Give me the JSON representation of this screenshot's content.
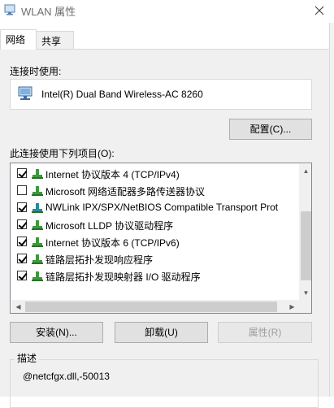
{
  "window": {
    "title": "WLAN 属性"
  },
  "tabs": [
    {
      "label": "网络",
      "active": true
    },
    {
      "label": "共享",
      "active": false
    }
  ],
  "connect_using": {
    "label": "连接时使用:",
    "adapter_name": "Intel(R) Dual Band Wireless-AC 8260",
    "configure_button": "配置(C)..."
  },
  "items_section": {
    "label": "此连接使用下列项目(O):",
    "items": [
      {
        "checked": true,
        "text": "Internet 协议版本 4 (TCP/IPv4)",
        "icon": "green-protocol-icon"
      },
      {
        "checked": false,
        "text": "Microsoft 网络适配器多路传送器协议",
        "icon": "green-protocol-icon"
      },
      {
        "checked": true,
        "text": "NWLink IPX/SPX/NetBIOS Compatible Transport Prot",
        "icon": "teal-protocol-icon"
      },
      {
        "checked": true,
        "text": "Microsoft LLDP 协议驱动程序",
        "icon": "green-protocol-icon"
      },
      {
        "checked": true,
        "text": "Internet 协议版本 6 (TCP/IPv6)",
        "icon": "green-protocol-icon"
      },
      {
        "checked": true,
        "text": "链路层拓扑发现响应程序",
        "icon": "green-protocol-icon"
      },
      {
        "checked": true,
        "text": "链路层拓扑发现映射器 I/O 驱动程序",
        "icon": "green-protocol-icon"
      }
    ]
  },
  "buttons": {
    "install": "安装(N)...",
    "uninstall": "卸载(U)",
    "properties": "属性(R)"
  },
  "description": {
    "title": "描述",
    "text": "@netcfgx.dll,-50013"
  },
  "colors": {
    "protocol_green": "#3c9a3c",
    "protocol_teal": "#2a8a9a",
    "panel_bg": "#f0f0f0"
  }
}
